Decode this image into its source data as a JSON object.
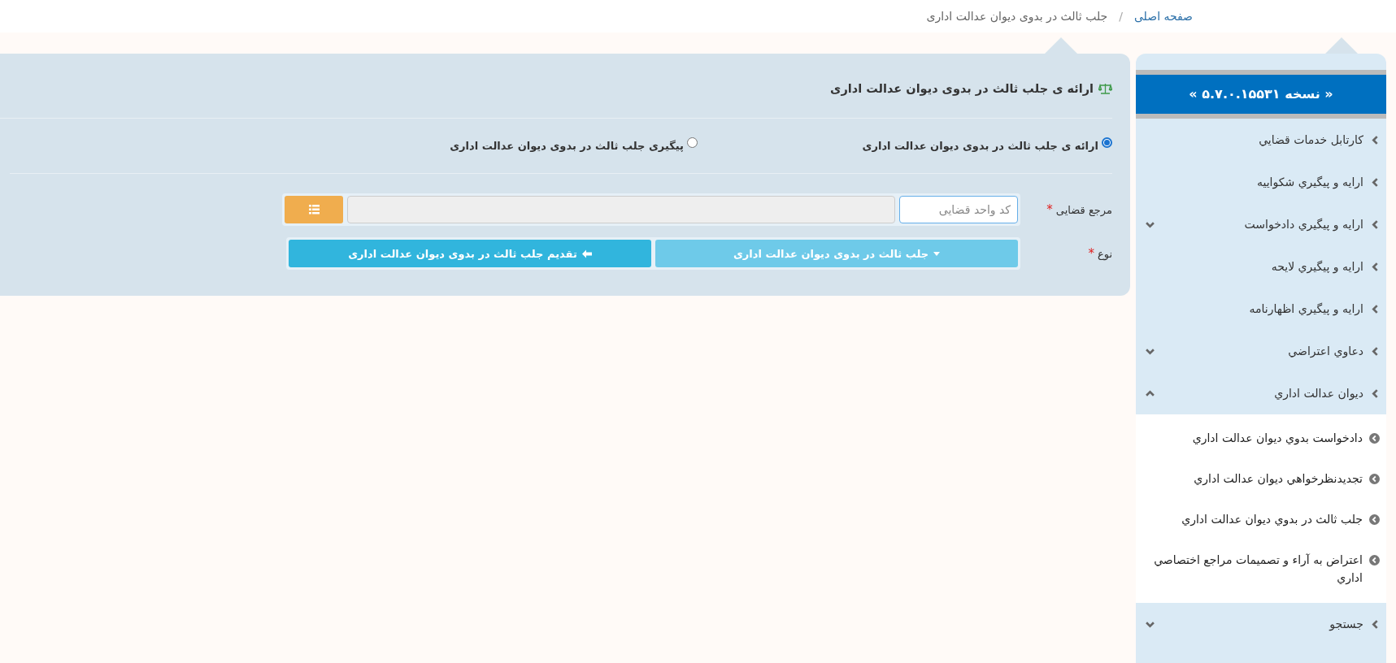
{
  "breadcrumb": [
    {
      "label": "صفحه اصلی",
      "kind": "link"
    },
    {
      "label": "/",
      "kind": "separator"
    },
    {
      "label": "جلب ثالث در بدوی دیوان عدالت اداری",
      "kind": "current"
    }
  ],
  "panel": {
    "title": "ارائه ی جلب ثالث در بدوی دیوان عدالت اداری",
    "options": [
      {
        "label": "ارائه ی جلب ثالث در بدوی دیوان عدالت اداری",
        "selected": true
      },
      {
        "label": "پیگیری جلب ثالث در بدوی دیوان عدالت اداری",
        "selected": false
      }
    ],
    "authority": {
      "label": "مرجع قضایی",
      "required_mark": "*",
      "code_placeholder": "کد واحد قضایی"
    },
    "type": {
      "label": "نوع",
      "required_mark": "*",
      "value": "جلب ثالث در بدوی دیوان عدالت اداری"
    },
    "submit": "تقدیم جلب ثالث در بدوی دیوان عدالت اداری"
  },
  "sidebar": {
    "version": "« نسخه ۵.۷.۰.۱۵۵۳۱ »",
    "items": [
      {
        "label": "كارتابل خدمات قضايي",
        "kind": "link"
      },
      {
        "label": "ارايه و پيگيري شكواييه",
        "kind": "link"
      },
      {
        "label": "ارايه و پيگيري دادخواست",
        "kind": "group",
        "expanded": false
      },
      {
        "label": "ارايه و پيگيري لايحه",
        "kind": "link"
      },
      {
        "label": "ارايه و پيگيري اظهارنامه",
        "kind": "link"
      },
      {
        "label": "دعاوي اعتراضي",
        "kind": "group",
        "expanded": false
      },
      {
        "label": "ديوان عدالت اداري",
        "kind": "group",
        "expanded": true,
        "children": [
          {
            "label": "دادخواست بدوي ديوان عدالت اداري"
          },
          {
            "label": "تجديدنظرخواهي ديوان عدالت اداري"
          },
          {
            "label": "جلب ثالث در بدوي ديوان عدالت اداري"
          },
          {
            "label": "اعتراض به آراء و تصميمات مراجع اختصاصي اداري"
          }
        ]
      },
      {
        "label": "جستجو",
        "kind": "group",
        "expanded": false
      }
    ]
  }
}
